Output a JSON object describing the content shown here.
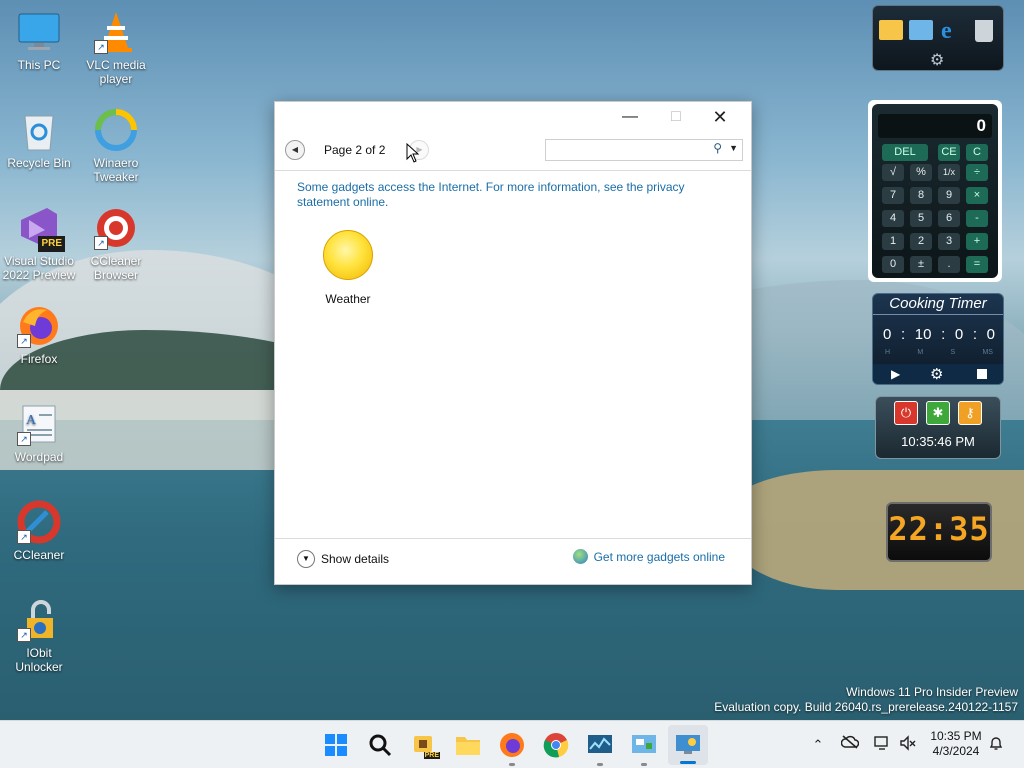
{
  "desktop_icons": [
    {
      "label": "This PC"
    },
    {
      "label": "VLC media player"
    },
    {
      "label": "Recycle Bin"
    },
    {
      "label": "Winaero Tweaker"
    },
    {
      "label": "Visual Studio 2022 Preview"
    },
    {
      "label": "CCleaner Browser"
    },
    {
      "label": "Firefox"
    },
    {
      "label": "Wordpad"
    },
    {
      "label": "CCleaner"
    },
    {
      "label": "IObit Unlocker"
    }
  ],
  "vs_badge": "PRE",
  "window": {
    "pager_label": "Page 2 of 2",
    "notice": "Some gadgets access the Internet.  For more information, see the privacy statement online.",
    "gadgets": [
      {
        "label": "Weather"
      }
    ],
    "show_details": "Show details",
    "get_more": "Get more gadgets online"
  },
  "calculator": {
    "display": "0",
    "rows": [
      [
        "DEL",
        "CE",
        "C"
      ],
      [
        "√",
        "%",
        "1/x",
        "÷"
      ],
      [
        "7",
        "8",
        "9",
        "×"
      ],
      [
        "4",
        "5",
        "6",
        "-"
      ],
      [
        "1",
        "2",
        "3",
        "+"
      ],
      [
        "0",
        "±",
        ".",
        "="
      ]
    ]
  },
  "cooking_timer": {
    "title": "Cooking Timer",
    "hours": "0",
    "minutes": "10",
    "seconds": "0",
    "ms": "0",
    "unit_labels": [
      "H",
      "M",
      "S",
      "MS"
    ]
  },
  "power_gadget": {
    "time": "10:35:46 PM"
  },
  "digital_clock": {
    "time": "22:35"
  },
  "watermark": {
    "line1": "Windows 11 Pro Insider Preview",
    "line2": "Evaluation copy. Build 26040.rs_prerelease.240122-1157"
  },
  "taskbar": {
    "clock_time": "10:35 PM",
    "clock_date": "4/3/2024",
    "pre_badge": "PRE"
  },
  "colors": {
    "link": "#1a6ea8",
    "win_blue": "#0078d4"
  }
}
